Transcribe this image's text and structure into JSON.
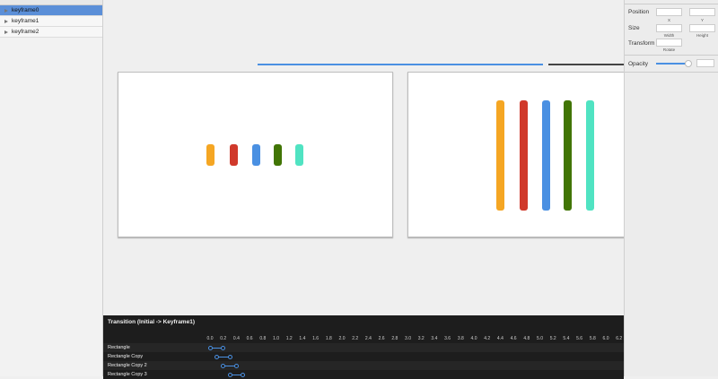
{
  "sidebar": {
    "items": [
      {
        "label": "keyframe0",
        "selected": true
      },
      {
        "label": "keyframe1"
      },
      {
        "label": "keyframe2"
      }
    ]
  },
  "inspector": {
    "position_label": "Position",
    "x_label": "X",
    "y_label": "Y",
    "size_label": "Size",
    "width_label": "Width",
    "height_label": "Height",
    "transform_label": "Transform",
    "rotate_label": "Rotate",
    "opacity_label": "Opacity",
    "opacity_value": 0.9
  },
  "colors": {
    "orange": "#f5a623",
    "red": "#d0392b",
    "blue": "#4a90e2",
    "green": "#417505",
    "teal": "#50e3c2"
  },
  "timeline": {
    "title": "Transition (Initial -> Keyframe1)",
    "ticks": [
      "0.0",
      "0.2",
      "0.4",
      "0.6",
      "0.8",
      "1.0",
      "1.2",
      "1.4",
      "1.6",
      "1.8",
      "2.0",
      "2.2",
      "2.4",
      "2.6",
      "2.8",
      "3.0",
      "3.2",
      "3.4",
      "3.6",
      "3.8",
      "4.0",
      "4.2",
      "4.4",
      "4.6",
      "4.8",
      "5.0",
      "5.2",
      "5.4",
      "5.6",
      "5.8",
      "6.0",
      "6.2"
    ],
    "rows": [
      {
        "label": "Rectangle",
        "start": 0.0,
        "end": 0.2
      },
      {
        "label": "Rectangle Copy",
        "start": 0.1,
        "end": 0.3
      },
      {
        "label": "Rectangle Copy 2",
        "start": 0.2,
        "end": 0.4
      },
      {
        "label": "Rectangle Copy 3",
        "start": 0.3,
        "end": 0.5
      }
    ]
  }
}
